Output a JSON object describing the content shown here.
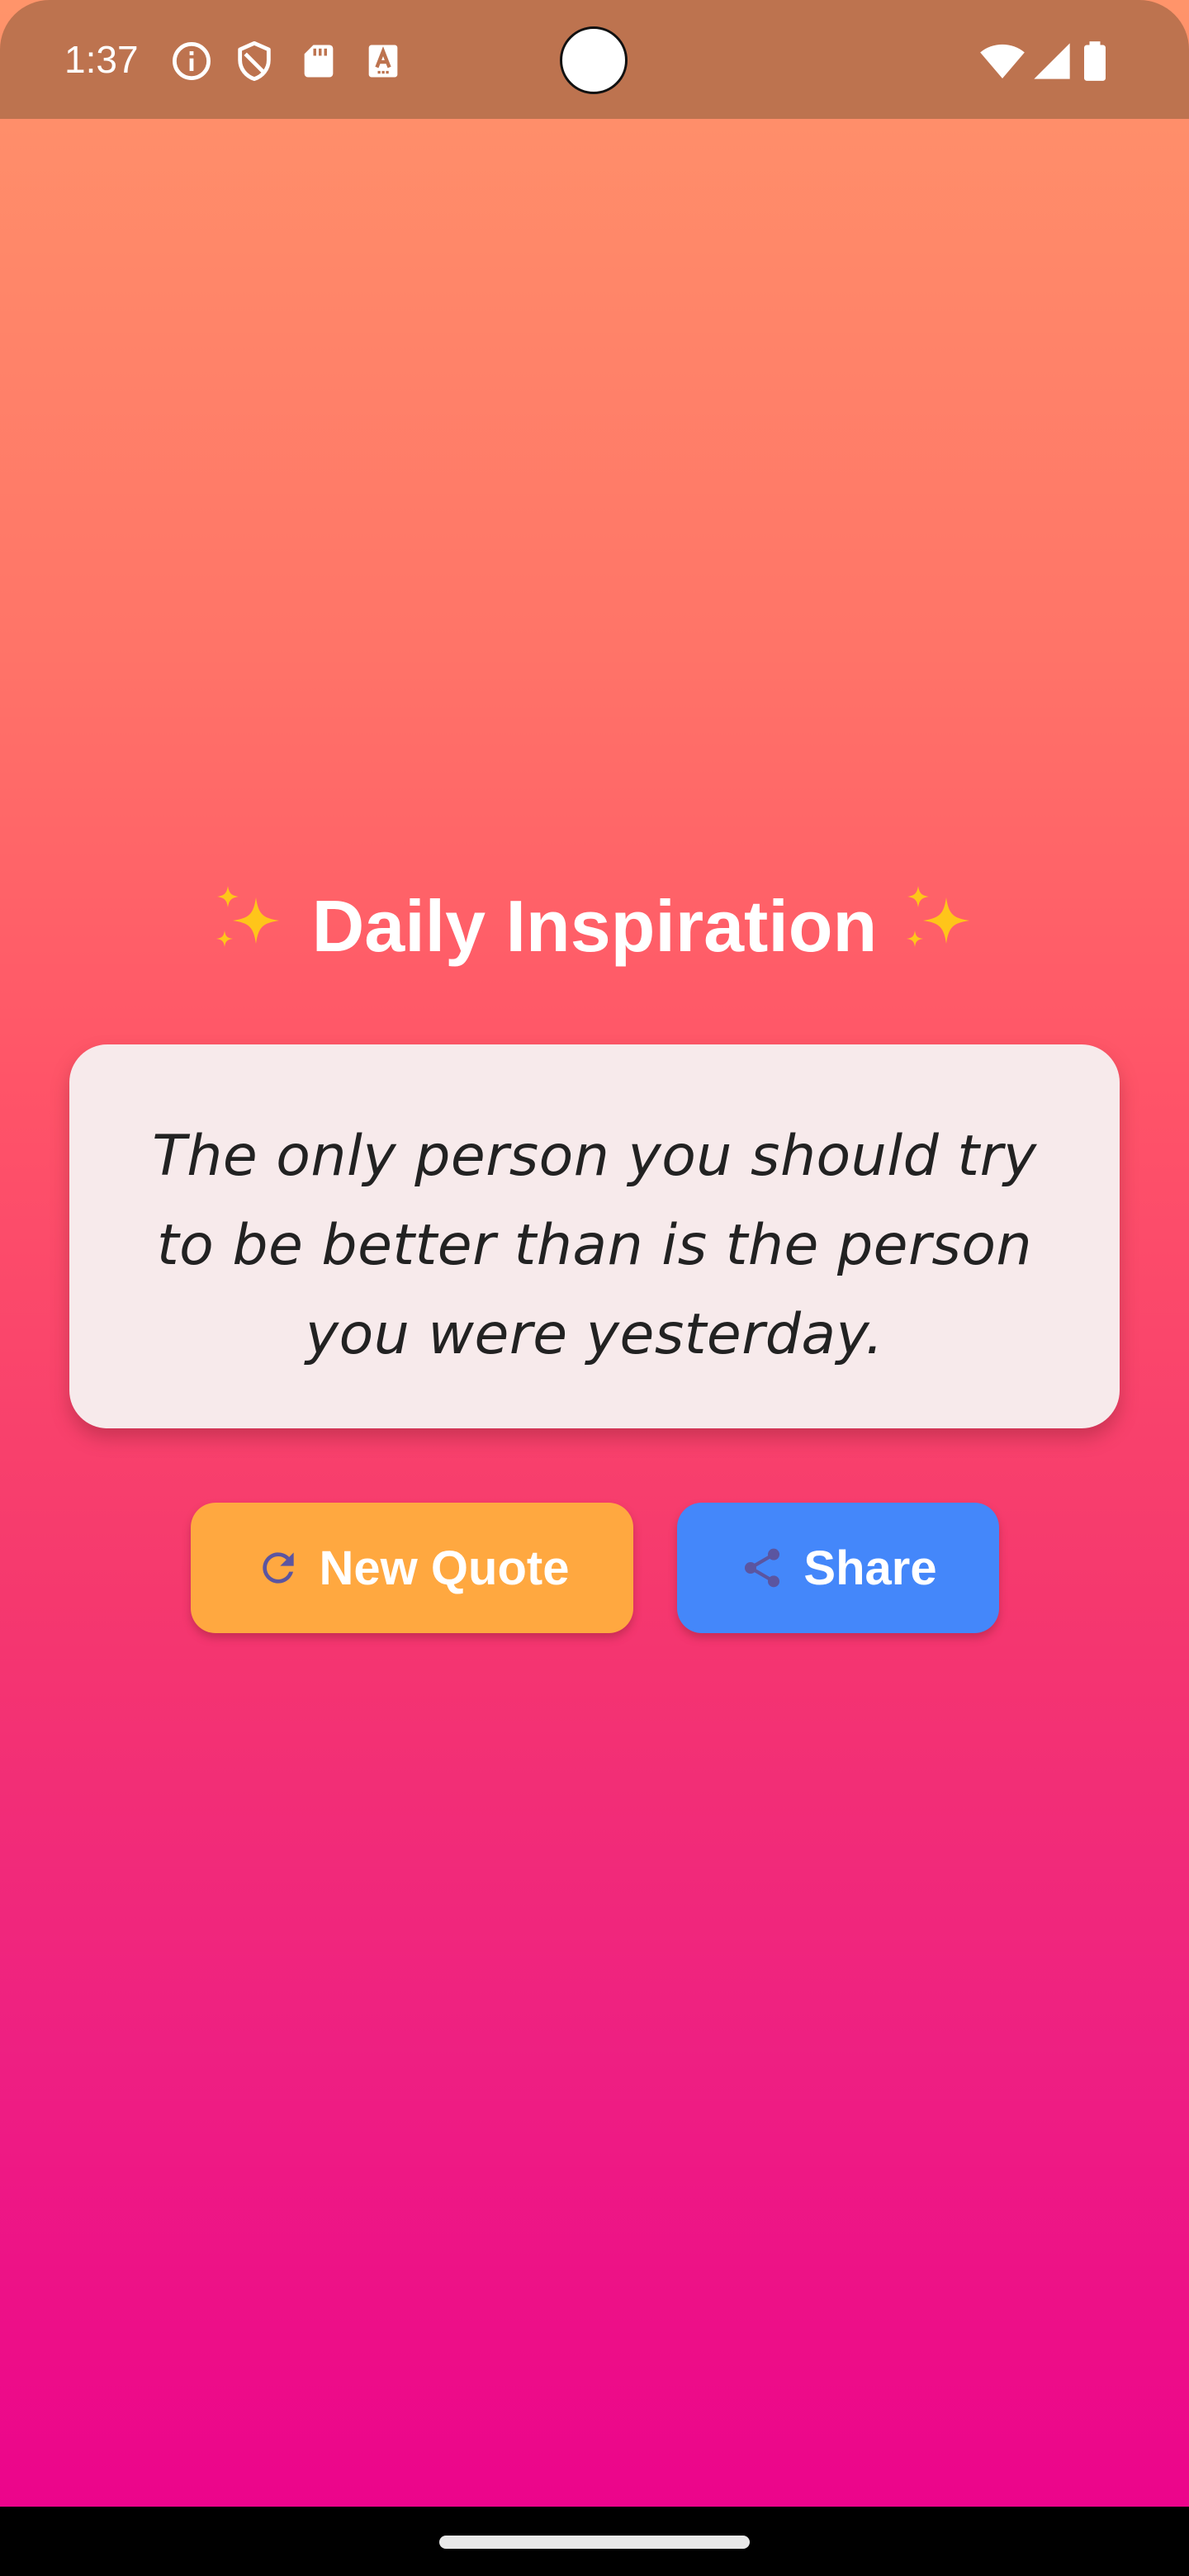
{
  "status_bar": {
    "time": "1:37",
    "left_icons": [
      "info-icon",
      "shield-icon",
      "sd-card-icon",
      "keyboard-a-icon"
    ],
    "right_icons": [
      "wifi-icon",
      "cellular-signal-icon",
      "battery-icon"
    ],
    "background": "#BD734F"
  },
  "main": {
    "title": "Daily Inspiration",
    "title_decoration_icon": "sparkles-icon",
    "quote": "The only person you should try to be better than is the person you were yesterday."
  },
  "actions": {
    "new_quote_label": "New Quote",
    "new_quote_icon": "refresh-icon",
    "new_quote_color": "#FFA840",
    "share_label": "Share",
    "share_icon": "share-icon",
    "share_color": "#4487FA"
  },
  "theme": {
    "gradient_top": "#FF946A",
    "gradient_bottom": "#EC008D",
    "card_background": "#F7EAEB",
    "icon_color": "#5B55A0"
  }
}
